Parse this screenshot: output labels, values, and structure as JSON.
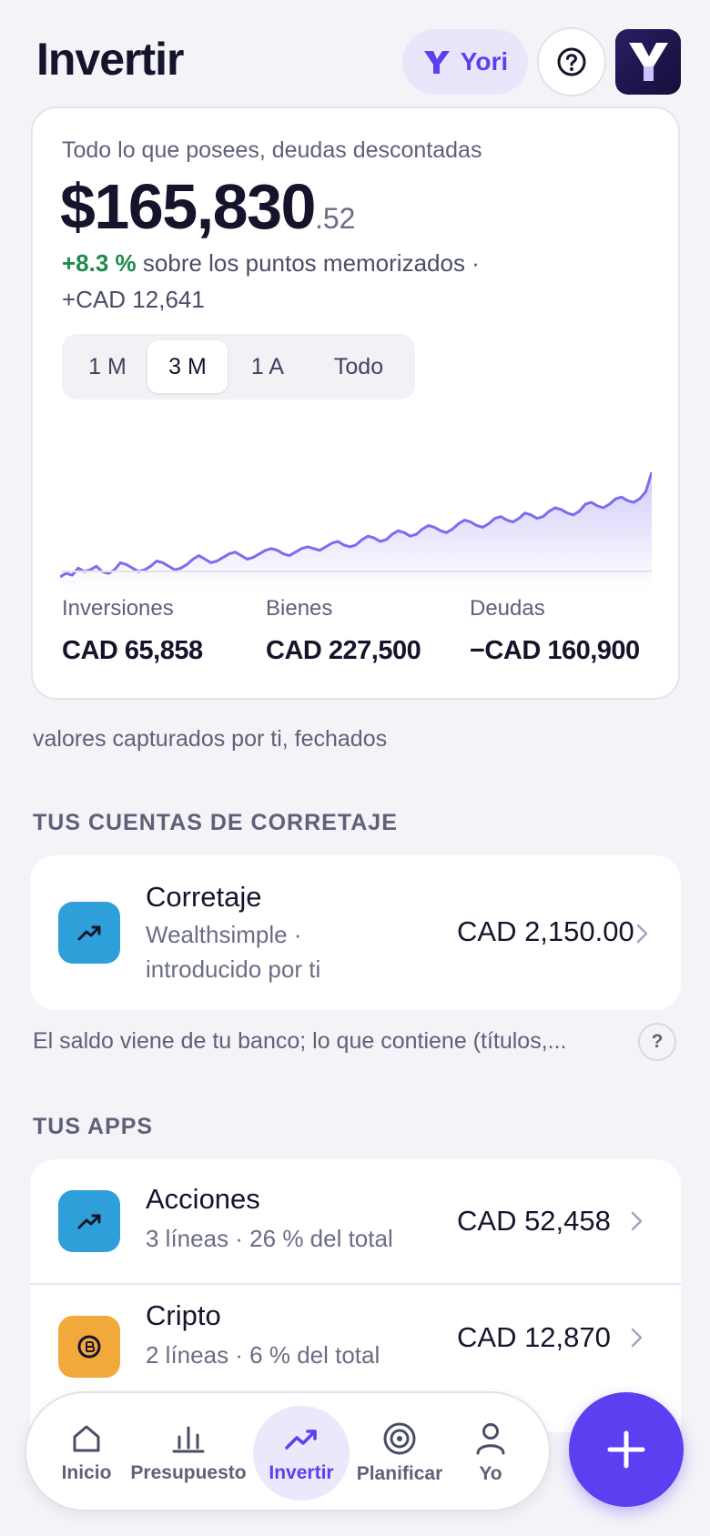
{
  "header": {
    "title": "Invertir",
    "assistant_label": "Yori"
  },
  "net_worth": {
    "caption": "Todo lo que posees, deudas descontadas",
    "amount_main": "$165,830",
    "amount_cents": ".52",
    "change_pct": "+8.3 %",
    "change_text": " sobre los puntos memorizados ·",
    "change_abs": "+CAD 12,641",
    "ranges": [
      "1 M",
      "3 M",
      "1 A",
      "Todo"
    ],
    "selected_range": "3 M",
    "stats": [
      {
        "label": "Inversiones",
        "value": "CAD 65,858"
      },
      {
        "label": "Bienes",
        "value": "CAD 227,500"
      },
      {
        "label": "Deudas",
        "value": "−CAD 160,900"
      }
    ]
  },
  "chart_data": {
    "type": "area",
    "series": [
      {
        "values": [
          62,
          64,
          63,
          67,
          65,
          66,
          68,
          65,
          64,
          66,
          70,
          69,
          67,
          65,
          66,
          68,
          71,
          70,
          68,
          66,
          67,
          69,
          72,
          74,
          72,
          70,
          71,
          73,
          75,
          76,
          74,
          72,
          73,
          75,
          77,
          78,
          77,
          75,
          74,
          76,
          78,
          79,
          78,
          77,
          79,
          81,
          82,
          80,
          79,
          80,
          83,
          85,
          84,
          82,
          83,
          86,
          88,
          87,
          85,
          86,
          89,
          91,
          90,
          88,
          87,
          89,
          92,
          94,
          93,
          91,
          90,
          92,
          95,
          96,
          94,
          93,
          95,
          98,
          97,
          95,
          96,
          99,
          101,
          100,
          98,
          97,
          99,
          103,
          104,
          102,
          101,
          103,
          106,
          107,
          105,
          104,
          106,
          110,
          121
        ]
      }
    ],
    "color": "#7b6cf0",
    "grid": false
  },
  "note": "valores capturados por ti, fechados",
  "brokerage": {
    "section_title": "TUS CUENTAS DE CORRETAJE",
    "items": [
      {
        "title": "Corretaje",
        "sub_line1": "Wealthsimple ·",
        "sub_line2": "introducido por ti",
        "amount": "CAD 2,150.00",
        "icon": "trending-up-icon",
        "icon_color": "#2e9fd8"
      }
    ],
    "explain": "El saldo viene de tu banco; lo que contiene (títulos,...",
    "help_glyph": "?"
  },
  "apps": {
    "section_title": "TUS APPS",
    "items": [
      {
        "title": "Acciones",
        "sub": "3 líneas · 26 % del total",
        "amount": "CAD 52,458",
        "icon": "trending-up-icon",
        "icon_color": "#2e9fd8"
      },
      {
        "title": "Cripto",
        "sub": "2 líneas · 6 % del total",
        "amount": "CAD 12,870",
        "icon": "crypto-coin-icon",
        "icon_color": "#f2a93b"
      }
    ]
  },
  "tabbar": {
    "items": [
      {
        "label": "Inicio",
        "icon": "home-icon"
      },
      {
        "label": "Presupuesto",
        "icon": "bar-chart-icon"
      },
      {
        "label": "Invertir",
        "icon": "trending-up-icon"
      },
      {
        "label": "Planificar",
        "icon": "target-icon"
      },
      {
        "label": "Yo",
        "icon": "user-icon"
      }
    ],
    "active": "Invertir"
  },
  "colors": {
    "accent": "#5b3ff0",
    "positive": "#1f8a4c",
    "background": "#f3f3f8"
  }
}
